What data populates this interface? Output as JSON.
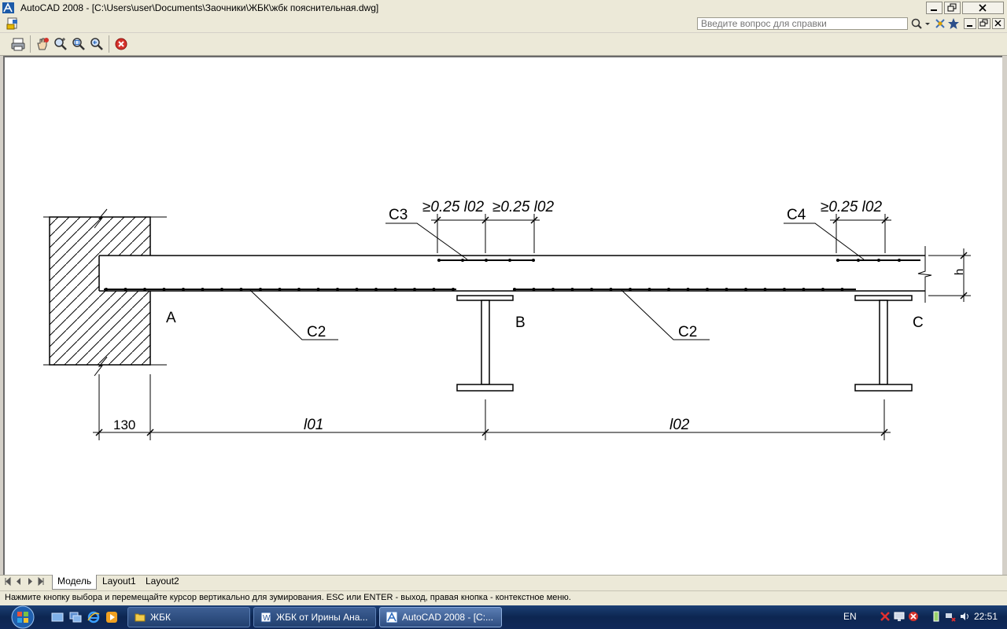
{
  "window": {
    "title": "AutoCAD 2008 - [C:\\Users\\user\\Documents\\Заочники\\ЖБК\\жбк пояснительная.dwg]"
  },
  "help": {
    "placeholder": "Введите вопрос для справки"
  },
  "toolbar": {
    "icons": [
      "print-icon",
      "pan-icon",
      "zoom-realtime-icon",
      "zoom-window-icon",
      "zoom-previous-icon",
      "close-preview-icon"
    ]
  },
  "drawing": {
    "support_labels": {
      "a": "A",
      "b": "B",
      "c": "C"
    },
    "bar_labels": {
      "left_bottom": "C2",
      "right_bottom": "C2",
      "top_middle": "C3",
      "top_right": "C4"
    },
    "dim_top_1": "≥0.25 l02",
    "dim_top_2": "≥0.25 l02",
    "dim_top_3": "≥0.25 l02",
    "dim_bottom_wall": "130",
    "dim_span_1": "l01",
    "dim_span_2": "l02",
    "dim_height": "h"
  },
  "layout_tabs": [
    "Модель",
    "Layout1",
    "Layout2"
  ],
  "status": {
    "message": "Нажмите кнопку выбора и перемещайте курсор вертикально для зумирования. ESC или ENTER - выход, правая кнопка - контекстное меню."
  },
  "taskbar": {
    "items": [
      {
        "label": "ЖБК",
        "icon": "folder-icon"
      },
      {
        "label": "ЖБК от Ирины Ана...",
        "icon": "word-icon"
      },
      {
        "label": "AutoCAD 2008 - [C:...",
        "icon": "autocad-icon"
      }
    ],
    "language": "EN",
    "clock": "22:51"
  },
  "colors": {
    "title_bg": "#ece9d8",
    "canvas_bg": "#ffffff",
    "line": "#000000",
    "taskbar_bg": "#0d2651",
    "close_red": "#d6322b"
  }
}
